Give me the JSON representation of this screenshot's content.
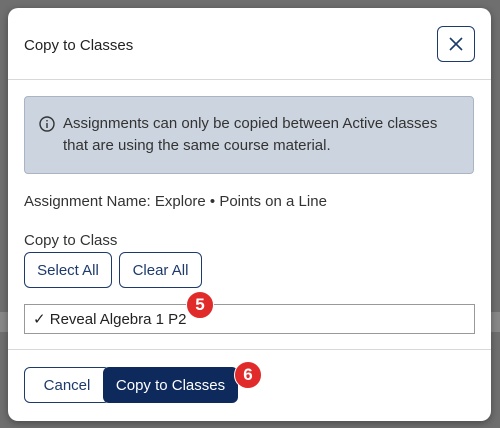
{
  "dialog": {
    "title": "Copy to Classes",
    "info_message": "Assignments can only be copied between Active classes that are using the same course material.",
    "assignment_name": "Assignment Name: Explore • Points on a Line",
    "copy_to_class_label": "Copy to Class",
    "select_all_label": "Select All",
    "clear_all_label": "Clear All",
    "classes": [
      {
        "label": "✓ Reveal Algebra 1 P2",
        "checked": true
      }
    ],
    "cancel_label": "Cancel",
    "copy_button_label": "Copy to Classes"
  },
  "annotations": {
    "step_5": "5",
    "step_6": "6"
  },
  "icons": {
    "close": "close-icon",
    "info": "info-icon"
  },
  "colors": {
    "primary": "#0e2a5c",
    "outline": "#1d3a6b",
    "info_bg": "#ccd4df",
    "badge": "#e12b2b"
  }
}
